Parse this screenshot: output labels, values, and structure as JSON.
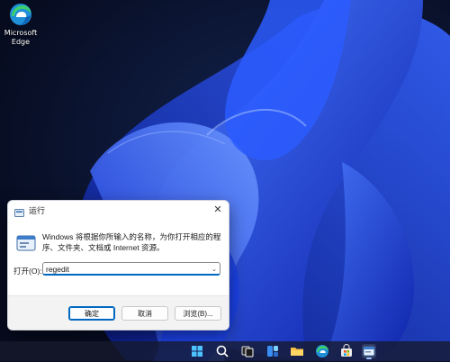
{
  "desktop": {
    "icons": [
      {
        "name": "edge-icon",
        "label": "Microsoft\nEdge"
      }
    ]
  },
  "run_dialog": {
    "title": "运行",
    "close_glyph": "✕",
    "description": "Windows 将根据你所输入的名称，为你打开相应的程序、文件夹、文档或 Internet 资源。",
    "open_label": "打开(O):",
    "input_value": "regedit",
    "dropdown_glyph": "⌄",
    "buttons": {
      "ok": "确定",
      "cancel": "取消",
      "browse": "浏览(B)..."
    }
  },
  "taskbar": {
    "items": [
      "start",
      "search",
      "task-view",
      "widgets",
      "file-explorer",
      "edge",
      "store",
      "run"
    ]
  },
  "colors": {
    "accent": "#0067c0",
    "wallpaper_bg": "#0a1028",
    "bloom": "#1d49ff"
  }
}
